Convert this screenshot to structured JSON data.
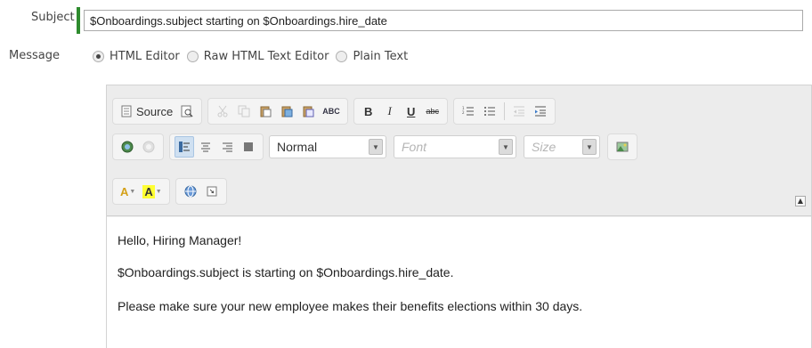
{
  "form": {
    "subject_label": "Subject",
    "subject_value": "$Onboardings.subject starting on $Onboardings.hire_date",
    "message_label": "Message",
    "mode_options": [
      {
        "label": "HTML Editor",
        "selected": true
      },
      {
        "label": "Raw HTML Text Editor",
        "selected": false
      },
      {
        "label": "Plain Text",
        "selected": false
      }
    ]
  },
  "toolbar": {
    "source_label": "Source",
    "spellcheck_label": "ABC",
    "bold": "B",
    "italic": "I",
    "underline": "U",
    "strike": "abc",
    "format_value": "Normal",
    "font_placeholder": "Font",
    "size_placeholder": "Size",
    "text_color_label": "A",
    "bg_color_label": "A",
    "icons": [
      "preview-icon",
      "cut-icon",
      "copy-icon",
      "paste-icon",
      "paste-text-icon",
      "paste-word-icon",
      "numbered-list-icon",
      "bulleted-list-icon",
      "outdent-icon",
      "indent-icon",
      "link-icon",
      "unlink-icon",
      "align-left-icon",
      "align-center-icon",
      "align-right-icon",
      "align-justify-icon",
      "image-icon",
      "globe-icon",
      "maximize-icon"
    ]
  },
  "content": {
    "line1": "Hello, Hiring Manager!",
    "line2": "$Onboardings.subject is starting on $Onboardings.hire_date.",
    "line3": "Please make sure your new employee makes their benefits elections within 30 days."
  },
  "colors": {
    "accent_bar": "#2e8b2e",
    "active_button": "#cfe0f1",
    "text_color": "#d4a017",
    "highlight": "#ffff33"
  }
}
